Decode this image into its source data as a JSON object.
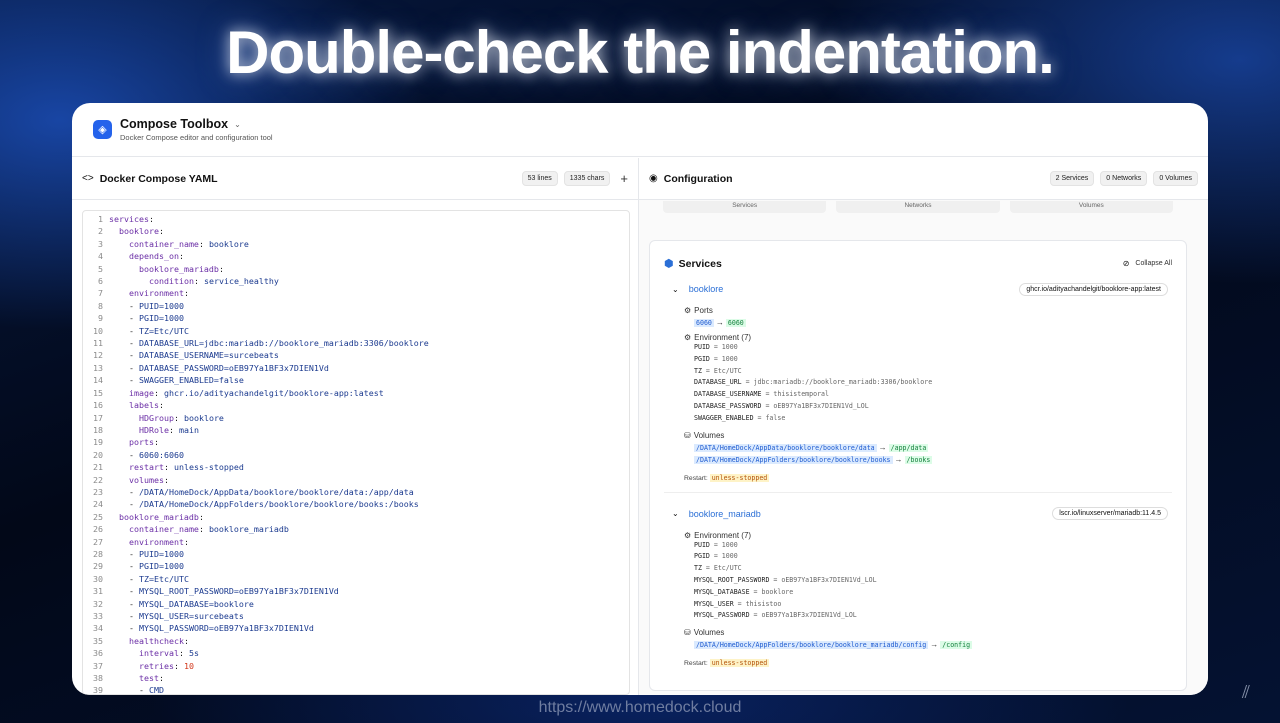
{
  "headline": "Double-check the indentation.",
  "url": "https://www.homedock.cloud",
  "app": {
    "title": "Compose Toolbox",
    "subtitle": "Docker Compose editor and configuration tool"
  },
  "left": {
    "title": "Docker Compose YAML",
    "lines_badge": "53 lines",
    "chars_badge": "1335 chars",
    "plus": "+"
  },
  "code_lines": [
    {
      "n": "1",
      "i": 0,
      "segs": [
        [
          "k",
          "services"
        ],
        [
          "t",
          ":"
        ]
      ]
    },
    {
      "n": "2",
      "i": 1,
      "segs": [
        [
          "k",
          "booklore"
        ],
        [
          "t",
          ":"
        ]
      ]
    },
    {
      "n": "3",
      "i": 2,
      "segs": [
        [
          "k",
          "container_name"
        ],
        [
          "t",
          ": "
        ],
        [
          "s",
          "booklore"
        ]
      ]
    },
    {
      "n": "4",
      "i": 2,
      "segs": [
        [
          "k",
          "depends_on"
        ],
        [
          "t",
          ":"
        ]
      ]
    },
    {
      "n": "5",
      "i": 3,
      "segs": [
        [
          "k",
          "booklore_mariadb"
        ],
        [
          "t",
          ":"
        ]
      ]
    },
    {
      "n": "6",
      "i": 4,
      "segs": [
        [
          "k",
          "condition"
        ],
        [
          "t",
          ": "
        ],
        [
          "s",
          "service_healthy"
        ]
      ]
    },
    {
      "n": "7",
      "i": 2,
      "segs": [
        [
          "k",
          "environment"
        ],
        [
          "t",
          ":"
        ]
      ]
    },
    {
      "n": "8",
      "i": 2,
      "segs": [
        [
          "t",
          "- "
        ],
        [
          "s",
          "PUID=1000"
        ]
      ]
    },
    {
      "n": "9",
      "i": 2,
      "segs": [
        [
          "t",
          "- "
        ],
        [
          "s",
          "PGID=1000"
        ]
      ]
    },
    {
      "n": "10",
      "i": 2,
      "segs": [
        [
          "t",
          "- "
        ],
        [
          "s",
          "TZ=Etc/UTC"
        ]
      ]
    },
    {
      "n": "11",
      "i": 2,
      "segs": [
        [
          "t",
          "- "
        ],
        [
          "s",
          "DATABASE_URL=jdbc:mariadb://booklore_mariadb:3306/booklore"
        ]
      ]
    },
    {
      "n": "12",
      "i": 2,
      "segs": [
        [
          "t",
          "- "
        ],
        [
          "s",
          "DATABASE_USERNAME=surcebeats"
        ]
      ]
    },
    {
      "n": "13",
      "i": 2,
      "segs": [
        [
          "t",
          "- "
        ],
        [
          "s",
          "DATABASE_PASSWORD=oEB97Ya1BF3x7DIEN1Vd"
        ]
      ]
    },
    {
      "n": "14",
      "i": 2,
      "segs": [
        [
          "t",
          "- "
        ],
        [
          "s",
          "SWAGGER_ENABLED=false"
        ]
      ]
    },
    {
      "n": "15",
      "i": 2,
      "segs": [
        [
          "k",
          "image"
        ],
        [
          "t",
          ": "
        ],
        [
          "s",
          "ghcr.io/adityachandelgit/booklore-app:latest"
        ]
      ]
    },
    {
      "n": "16",
      "i": 2,
      "segs": [
        [
          "k",
          "labels"
        ],
        [
          "t",
          ":"
        ]
      ]
    },
    {
      "n": "17",
      "i": 3,
      "segs": [
        [
          "k",
          "HDGroup"
        ],
        [
          "t",
          ": "
        ],
        [
          "s",
          "booklore"
        ]
      ]
    },
    {
      "n": "18",
      "i": 3,
      "segs": [
        [
          "k",
          "HDRole"
        ],
        [
          "t",
          ": "
        ],
        [
          "s",
          "main"
        ]
      ]
    },
    {
      "n": "19",
      "i": 2,
      "segs": [
        [
          "k",
          "ports"
        ],
        [
          "t",
          ":"
        ]
      ]
    },
    {
      "n": "20",
      "i": 2,
      "segs": [
        [
          "t",
          "- "
        ],
        [
          "s",
          "6060:6060"
        ]
      ]
    },
    {
      "n": "21",
      "i": 2,
      "segs": [
        [
          "k",
          "restart"
        ],
        [
          "t",
          ": "
        ],
        [
          "s",
          "unless-stopped"
        ]
      ]
    },
    {
      "n": "22",
      "i": 2,
      "segs": [
        [
          "k",
          "volumes"
        ],
        [
          "t",
          ":"
        ]
      ]
    },
    {
      "n": "23",
      "i": 2,
      "segs": [
        [
          "t",
          "- "
        ],
        [
          "s",
          "/DATA/HomeDock/AppData/booklore/booklore/data:/app/data"
        ]
      ]
    },
    {
      "n": "24",
      "i": 2,
      "segs": [
        [
          "t",
          "- "
        ],
        [
          "s",
          "/DATA/HomeDock/AppFolders/booklore/booklore/books:/books"
        ]
      ]
    },
    {
      "n": "25",
      "i": 1,
      "segs": [
        [
          "k",
          "booklore_mariadb"
        ],
        [
          "t",
          ":"
        ]
      ]
    },
    {
      "n": "26",
      "i": 2,
      "segs": [
        [
          "k",
          "container_name"
        ],
        [
          "t",
          ": "
        ],
        [
          "s",
          "booklore_mariadb"
        ]
      ]
    },
    {
      "n": "27",
      "i": 2,
      "segs": [
        [
          "k",
          "environment"
        ],
        [
          "t",
          ":"
        ]
      ]
    },
    {
      "n": "28",
      "i": 2,
      "segs": [
        [
          "t",
          "- "
        ],
        [
          "s",
          "PUID=1000"
        ]
      ]
    },
    {
      "n": "29",
      "i": 2,
      "segs": [
        [
          "t",
          "- "
        ],
        [
          "s",
          "PGID=1000"
        ]
      ]
    },
    {
      "n": "30",
      "i": 2,
      "segs": [
        [
          "t",
          "- "
        ],
        [
          "s",
          "TZ=Etc/UTC"
        ]
      ]
    },
    {
      "n": "31",
      "i": 2,
      "segs": [
        [
          "t",
          "- "
        ],
        [
          "s",
          "MYSQL_ROOT_PASSWORD=oEB97Ya1BF3x7DIEN1Vd"
        ]
      ]
    },
    {
      "n": "32",
      "i": 2,
      "segs": [
        [
          "t",
          "- "
        ],
        [
          "s",
          "MYSQL_DATABASE=booklore"
        ]
      ]
    },
    {
      "n": "33",
      "i": 2,
      "segs": [
        [
          "t",
          "- "
        ],
        [
          "s",
          "MYSQL_USER=surcebeats"
        ]
      ]
    },
    {
      "n": "34",
      "i": 2,
      "segs": [
        [
          "t",
          "- "
        ],
        [
          "s",
          "MYSQL_PASSWORD=oEB97Ya1BF3x7DIEN1Vd"
        ]
      ]
    },
    {
      "n": "35",
      "i": 2,
      "segs": [
        [
          "k",
          "healthcheck"
        ],
        [
          "t",
          ":"
        ]
      ]
    },
    {
      "n": "36",
      "i": 3,
      "segs": [
        [
          "k",
          "interval"
        ],
        [
          "t",
          ": "
        ],
        [
          "s",
          "5s"
        ]
      ]
    },
    {
      "n": "37",
      "i": 3,
      "segs": [
        [
          "k",
          "retries"
        ],
        [
          "t",
          ": "
        ],
        [
          "n",
          "10"
        ]
      ]
    },
    {
      "n": "38",
      "i": 3,
      "segs": [
        [
          "k",
          "test"
        ],
        [
          "t",
          ":"
        ]
      ]
    },
    {
      "n": "39",
      "i": 3,
      "segs": [
        [
          "t",
          "- "
        ],
        [
          "s",
          "CMD"
        ]
      ]
    }
  ],
  "right": {
    "title": "Configuration",
    "services_badge": "2 Services",
    "networks_badge": "0 Networks",
    "volumes_badge": "0 Volumes",
    "tabs": [
      "Services",
      "Networks",
      "Volumes"
    ],
    "card_title": "Services",
    "collapse_label": "Collapse All",
    "svc1": {
      "name": "booklore",
      "image": "ghcr.io/adityachandelgit/booklore-app:latest",
      "ports_label": "Ports",
      "port_host": "6060",
      "port_container": "6060",
      "env_label": "Environment (7)",
      "env": [
        [
          "PUID",
          "1000"
        ],
        [
          "PGID",
          "1000"
        ],
        [
          "TZ",
          "Etc/UTC"
        ],
        [
          "DATABASE_URL",
          "jdbc:mariadb://booklore_mariadb:3306/booklore"
        ],
        [
          "DATABASE_USERNAME",
          "thisistemporal"
        ],
        [
          "DATABASE_PASSWORD",
          "oEB97Ya1BF3x7DIEN1Vd_LOL"
        ],
        [
          "SWAGGER_ENABLED",
          "false"
        ]
      ],
      "vol_label": "Volumes",
      "vols": [
        [
          "/DATA/HomeDock/AppData/booklore/booklore/data",
          "/app/data"
        ],
        [
          "/DATA/HomeDock/AppFolders/booklore/booklore/books",
          "/books"
        ]
      ],
      "restart_label": "Restart:",
      "restart": "unless-stopped"
    },
    "svc2": {
      "name": "booklore_mariadb",
      "image": "lscr.io/linuxserver/mariadb:11.4.5",
      "env_label": "Environment (7)",
      "env": [
        [
          "PUID",
          "1000"
        ],
        [
          "PGID",
          "1000"
        ],
        [
          "TZ",
          "Etc/UTC"
        ],
        [
          "MYSQL_ROOT_PASSWORD",
          "oEB97Ya1BF3x7DIEN1Vd_LOL"
        ],
        [
          "MYSQL_DATABASE",
          "booklore"
        ],
        [
          "MYSQL_USER",
          "thisistoo"
        ],
        [
          "MYSQL_PASSWORD",
          "oEB97Ya1BF3x7DIEN1Vd_LOL"
        ]
      ],
      "vol_label": "Volumes",
      "vols": [
        [
          "/DATA/HomeDock/AppFolders/booklore/booklore_mariadb/config",
          "/config"
        ]
      ],
      "restart_label": "Restart:",
      "restart": "unless-stopped"
    }
  }
}
